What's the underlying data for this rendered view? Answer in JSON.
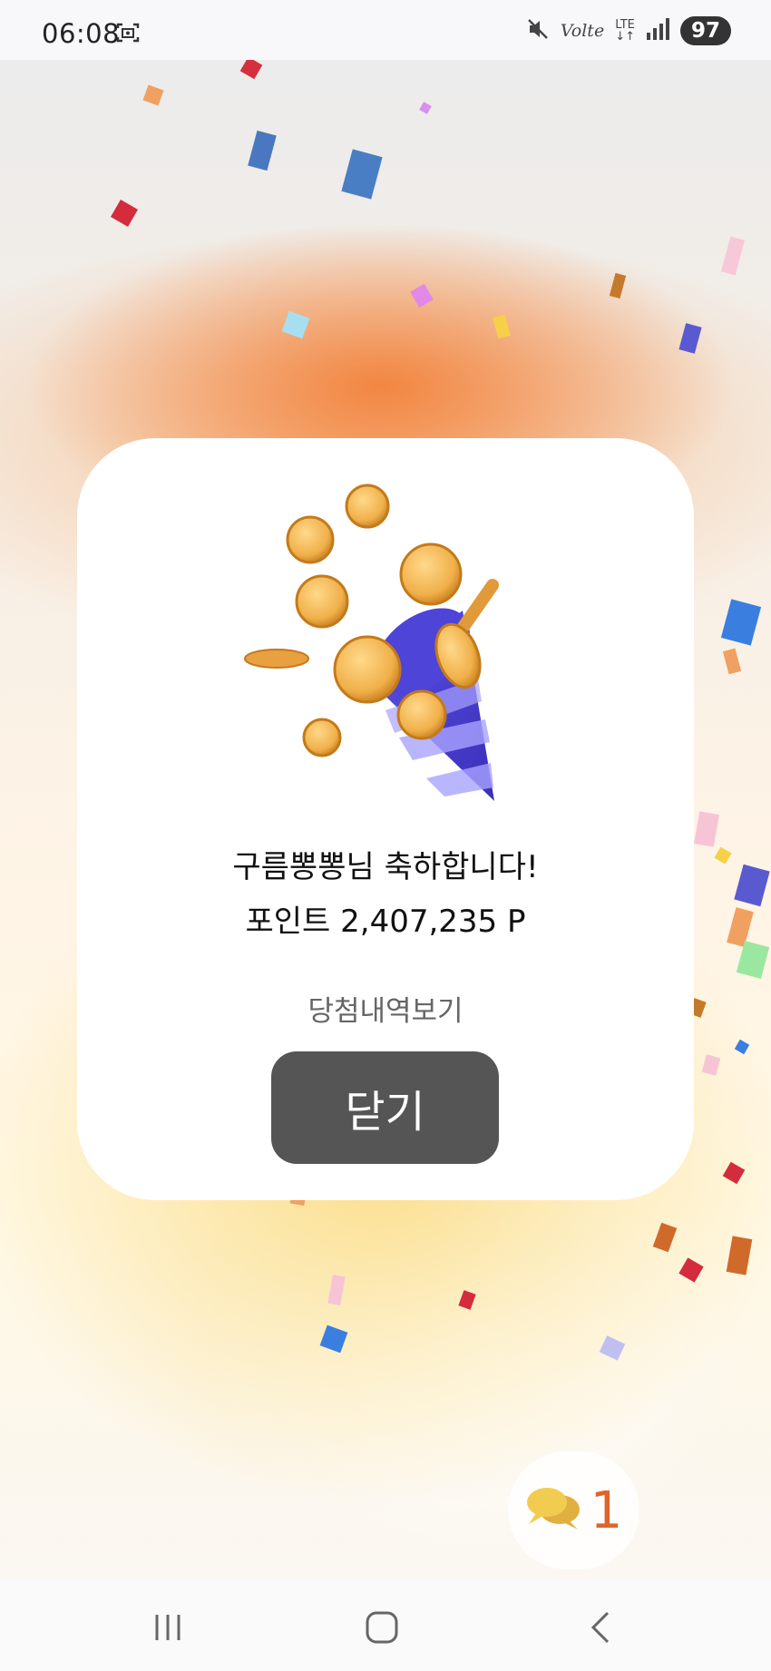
{
  "status_bar": {
    "time": "06:08",
    "network_label": "Volte",
    "lte_label": "LTE",
    "battery": "97"
  },
  "dialog": {
    "congrats_text": "구름뽕뽕님 축하합니다!",
    "points_text": "포인트 2,407,235 P",
    "history_link": "당첨내역보기",
    "close_label": "닫기"
  },
  "chat": {
    "count": "1",
    "icon": "chat-bubbles-icon"
  },
  "colors": {
    "accent_orange": "#e0632a",
    "close_button": "#555555",
    "background_orange": "#f2823c"
  },
  "navigation": {
    "recents_icon": "recents-icon",
    "home_icon": "home-icon",
    "back_icon": "back-icon"
  }
}
